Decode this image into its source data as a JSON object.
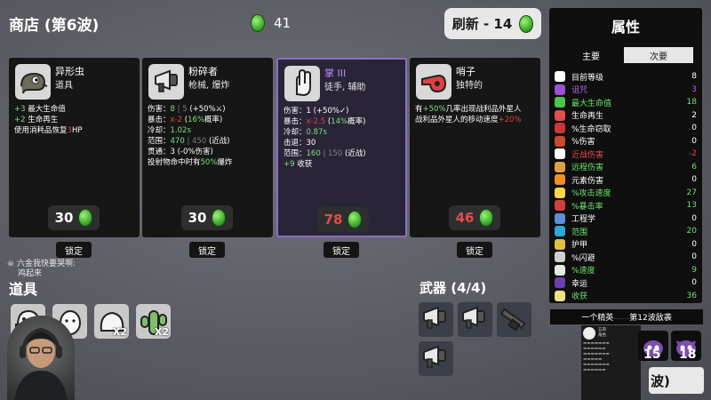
{
  "header": {
    "shop_title": "商店 (第6波)",
    "gold": "41",
    "reroll_label": "刷新 - 14"
  },
  "cards": [
    {
      "name": "异形虫",
      "type": "道具",
      "lines": [
        {
          "parts": [
            {
              "t": "+3",
              "c": "g"
            },
            {
              "t": " 最大生命值",
              "c": ""
            }
          ]
        },
        {
          "parts": [
            {
              "t": "+2",
              "c": "g"
            },
            {
              "t": " 生命再生",
              "c": ""
            }
          ]
        },
        {
          "parts": [
            {
              "t": "使用消耗品恢复",
              "c": ""
            },
            {
              "t": "3",
              "c": "r"
            },
            {
              "t": "HP",
              "c": ""
            }
          ]
        }
      ],
      "price": "30",
      "price_color": "white",
      "lock_label": "锁定",
      "icon": "alien-worm-icon"
    },
    {
      "name": "粉碎者",
      "type": "枪械, 爆炸",
      "lines": [
        {
          "parts": [
            {
              "t": "伤害：",
              "c": ""
            },
            {
              "t": "8",
              "c": "g"
            },
            {
              "t": " | 5 ",
              "c": "d"
            },
            {
              "t": "(+50%⚔)",
              "c": ""
            }
          ]
        },
        {
          "parts": [
            {
              "t": "暴击：",
              "c": ""
            },
            {
              "t": "x-2",
              "c": "r"
            },
            {
              "t": " (",
              "c": ""
            },
            {
              "t": "16%",
              "c": "g"
            },
            {
              "t": "概率)",
              "c": ""
            }
          ]
        },
        {
          "parts": [
            {
              "t": "冷却：",
              "c": ""
            },
            {
              "t": "1.02s",
              "c": "g"
            }
          ]
        },
        {
          "parts": [
            {
              "t": "范围：",
              "c": ""
            },
            {
              "t": "470",
              "c": "g"
            },
            {
              "t": " | 450 ",
              "c": "d"
            },
            {
              "t": "(近战)",
              "c": ""
            }
          ]
        },
        {
          "parts": [
            {
              "t": "贯通：3 (-0%伤害)",
              "c": ""
            }
          ]
        },
        {
          "parts": [
            {
              "t": "投射物命中时有",
              "c": ""
            },
            {
              "t": "50%",
              "c": "g"
            },
            {
              "t": "爆炸",
              "c": ""
            }
          ]
        }
      ],
      "price": "30",
      "price_color": "white",
      "lock_label": "锁定",
      "icon": "megaphone-gun-icon"
    },
    {
      "name": "掌 III",
      "type": "徒手, 辅助",
      "lines": [
        {
          "parts": [
            {
              "t": "伤害：1 (+50%✓)",
              "c": ""
            }
          ]
        },
        {
          "parts": [
            {
              "t": "暴击：",
              "c": ""
            },
            {
              "t": "x-2.5",
              "c": "r"
            },
            {
              "t": " (",
              "c": ""
            },
            {
              "t": "14%",
              "c": "g"
            },
            {
              "t": "概率)",
              "c": ""
            }
          ]
        },
        {
          "parts": [
            {
              "t": "冷却：",
              "c": ""
            },
            {
              "t": "0.87s",
              "c": "g"
            }
          ]
        },
        {
          "parts": [
            {
              "t": "击退：30",
              "c": ""
            }
          ]
        },
        {
          "parts": [
            {
              "t": "范围：",
              "c": ""
            },
            {
              "t": "160",
              "c": "g"
            },
            {
              "t": " | 150 ",
              "c": "d"
            },
            {
              "t": "(近战)",
              "c": ""
            }
          ]
        },
        {
          "parts": [
            {
              "t": "+9",
              "c": "g"
            },
            {
              "t": " 收获",
              "c": ""
            }
          ]
        }
      ],
      "price": "78",
      "price_color": "red",
      "lock_label": "锁定",
      "icon": "palm-hand-icon"
    },
    {
      "name": "哨子",
      "type": "独特的",
      "lines": [
        {
          "parts": [
            {
              "t": "有",
              "c": ""
            },
            {
              "t": "+50%",
              "c": "g"
            },
            {
              "t": "几率出现战利品外星人",
              "c": ""
            }
          ]
        },
        {
          "parts": [
            {
              "t": "战利品外星人的移动速度",
              "c": ""
            },
            {
              "t": "+20%",
              "c": "r"
            }
          ]
        }
      ],
      "price": "46",
      "price_color": "red",
      "lock_label": "锁定",
      "icon": "whistle-icon"
    }
  ],
  "chat": {
    "line1": "六金我快要哭啊:",
    "line2": "鸡起来"
  },
  "inventory": {
    "title": "道具",
    "items": [
      {
        "icon": "helmet-item-icon",
        "count": ""
      },
      {
        "icon": "egg-item-icon",
        "count": ""
      },
      {
        "icon": "ghost-blob-item-icon",
        "count": "X2"
      },
      {
        "icon": "cactus-item-icon",
        "count": "X2"
      }
    ]
  },
  "weapons": {
    "title": "武器 (4/4)",
    "items": [
      {
        "icon": "megaphone-gun-icon"
      },
      {
        "icon": "megaphone-gun-icon"
      },
      {
        "icon": "shotgun-icon"
      },
      {
        "icon": "megaphone-gun-icon"
      }
    ]
  },
  "stats": {
    "title": "属性",
    "tab_primary": "主要",
    "tab_secondary": "次要",
    "rows": [
      {
        "label": "目前等级",
        "value": "8",
        "color": "#ffffff",
        "icon_color": "#ffffff"
      },
      {
        "label": "诅咒",
        "value": "3",
        "color": "#b565f0",
        "icon_color": "#9b4fd6"
      },
      {
        "label": "最大生命值",
        "value": "18",
        "color": "#6fe06f",
        "icon_color": "#49c64a"
      },
      {
        "label": "生命再生",
        "value": "2",
        "color": "#ffffff",
        "icon_color": "#e24c4c"
      },
      {
        "label": "%生命窃取",
        "value": "0",
        "color": "#ffffff",
        "icon_color": "#c83737"
      },
      {
        "label": "%伤害",
        "value": "0",
        "color": "#ffffff",
        "icon_color": "#c84b2d"
      },
      {
        "label": "近战伤害",
        "value": "-2",
        "color": "#e24c4c",
        "icon_color": "#ffffff"
      },
      {
        "label": "远程伤害",
        "value": "6",
        "color": "#6fe06f",
        "icon_color": "#e0a040"
      },
      {
        "label": "元素伤害",
        "value": "0",
        "color": "#ffffff",
        "icon_color": "#f09020"
      },
      {
        "label": "%攻击速度",
        "value": "27",
        "color": "#6fe06f",
        "icon_color": "#ffd740"
      },
      {
        "label": "%暴击率",
        "value": "13",
        "color": "#6fe06f",
        "icon_color": "#d04040"
      },
      {
        "label": "工程学",
        "value": "0",
        "color": "#ffffff",
        "icon_color": "#5b8fd9"
      },
      {
        "label": "范围",
        "value": "20",
        "color": "#6fe06f",
        "icon_color": "#2ea8d9"
      },
      {
        "label": "护甲",
        "value": "0",
        "color": "#ffffff",
        "icon_color": "#e0c040"
      },
      {
        "label": "%闪避",
        "value": "0",
        "color": "#ffffff",
        "icon_color": "#cfcfcf"
      },
      {
        "label": "%速度",
        "value": "9",
        "color": "#6fe06f",
        "icon_color": "#e8e8e8"
      },
      {
        "label": "幸运",
        "value": "0",
        "color": "#ffffff",
        "icon_color": "#6a3fb2"
      },
      {
        "label": "收获",
        "value": "36",
        "color": "#6fe06f",
        "icon_color": "#f0e080"
      }
    ]
  },
  "bottom_right": {
    "tooltip_left": "一个精英",
    "tooltip_right": "第12波敌袭",
    "enemy_counts": [
      "15",
      "18"
    ],
    "wave_text": "波)",
    "popup_name": "五哥",
    "popup_sub": "角色"
  },
  "colors": {
    "green": "#7ae07a",
    "red": "#e0473f",
    "purple_border": "#8a6fc4"
  }
}
